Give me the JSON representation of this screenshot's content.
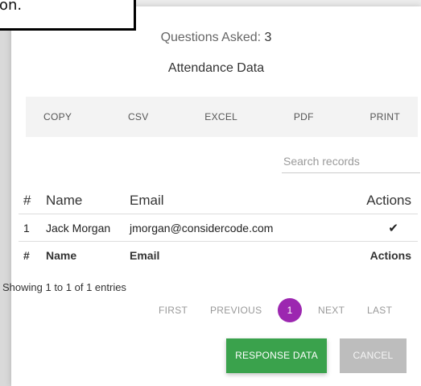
{
  "callout": {
    "text": "on."
  },
  "header": {
    "questions_label": "Questions Asked:",
    "questions_count": "3",
    "title": "Attendance Data"
  },
  "toolbar": {
    "buttons": [
      "COPY",
      "CSV",
      "EXCEL",
      "PDF",
      "PRINT"
    ]
  },
  "search": {
    "placeholder": "Search records",
    "value": ""
  },
  "table": {
    "columns": [
      "#",
      "Name",
      "Email",
      "Actions"
    ],
    "rows": [
      {
        "num": "1",
        "name": "Jack Morgan",
        "email": "jmorgan@considercode.com",
        "action_icon": "check-icon"
      }
    ],
    "footer": [
      "#",
      "Name",
      "Email",
      "Actions"
    ]
  },
  "info": "Showing 1 to 1 of 1 entries",
  "pagination": {
    "first": "FIRST",
    "previous": "PREVIOUS",
    "current": "1",
    "next": "NEXT",
    "last": "LAST"
  },
  "buttons": {
    "response": "RESPONSE DATA",
    "cancel": "CANCEL"
  },
  "colors": {
    "accent_purple": "#9c27b0",
    "response_green": "#3aa24c",
    "cancel_grey": "#bdbdbd"
  }
}
